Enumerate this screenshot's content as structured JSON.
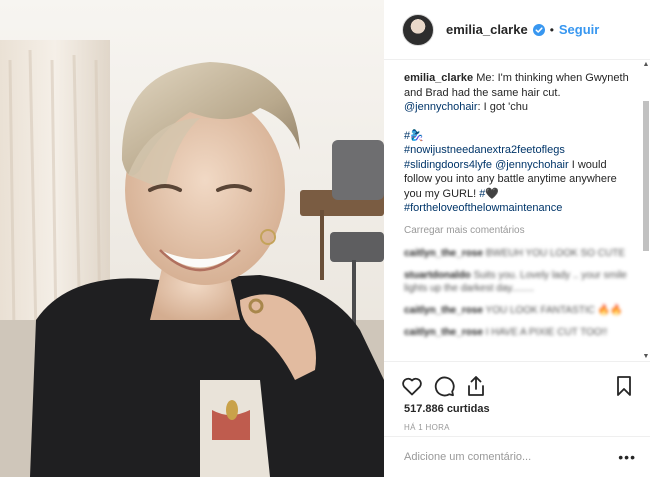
{
  "post": {
    "photo_icon": "photo-selfie",
    "header": {
      "username": "emilia_clarke",
      "verified_icon": "verified-badge-icon",
      "separator": "•",
      "follow_label": "Seguir",
      "follow_color": "#3897f0"
    },
    "caption": {
      "username": "emilia_clarke",
      "text_1": "Me: I'm thinking when Gwyneth and Brad had the same hair cut.",
      "mention_1": "@jennychohair",
      "text_2": ": I got 'chu",
      "hashtag_emoji": "#🧞‍♀️",
      "hashtag_1": "#nowijustneedanextra2feetoflegs",
      "hashtag_2": "#slidingdoors4lyfe",
      "mention_2": "@jennychohair",
      "text_3": "I would follow you into any battle anytime anywhere you my GURL!",
      "hashtag_heart": "#🖤",
      "hashtag_3": "#fortheloveofthelowmaintenance"
    },
    "load_more": "Carregar mais comentários",
    "comments": [
      {
        "user": "caitlyn_the_rose",
        "text": "BWEUH YOU LOOK SO CUTE"
      },
      {
        "user": "stuartdonaldo",
        "text": "Suits you. Lovely lady .. your smile lights up the darkest day........"
      },
      {
        "user": "caitlyn_the_rose",
        "text": "YOU LOOK FANTASTIC 🔥🔥"
      },
      {
        "user": "caitlyn_the_rose",
        "text": "I HAVE A PIXIE CUT TOO!!"
      }
    ],
    "likes": "517.886 curtidas",
    "timestamp": "HÁ 1 HORA",
    "add_comment_placeholder": "Adicione um comentário...",
    "more_options": "•••"
  }
}
